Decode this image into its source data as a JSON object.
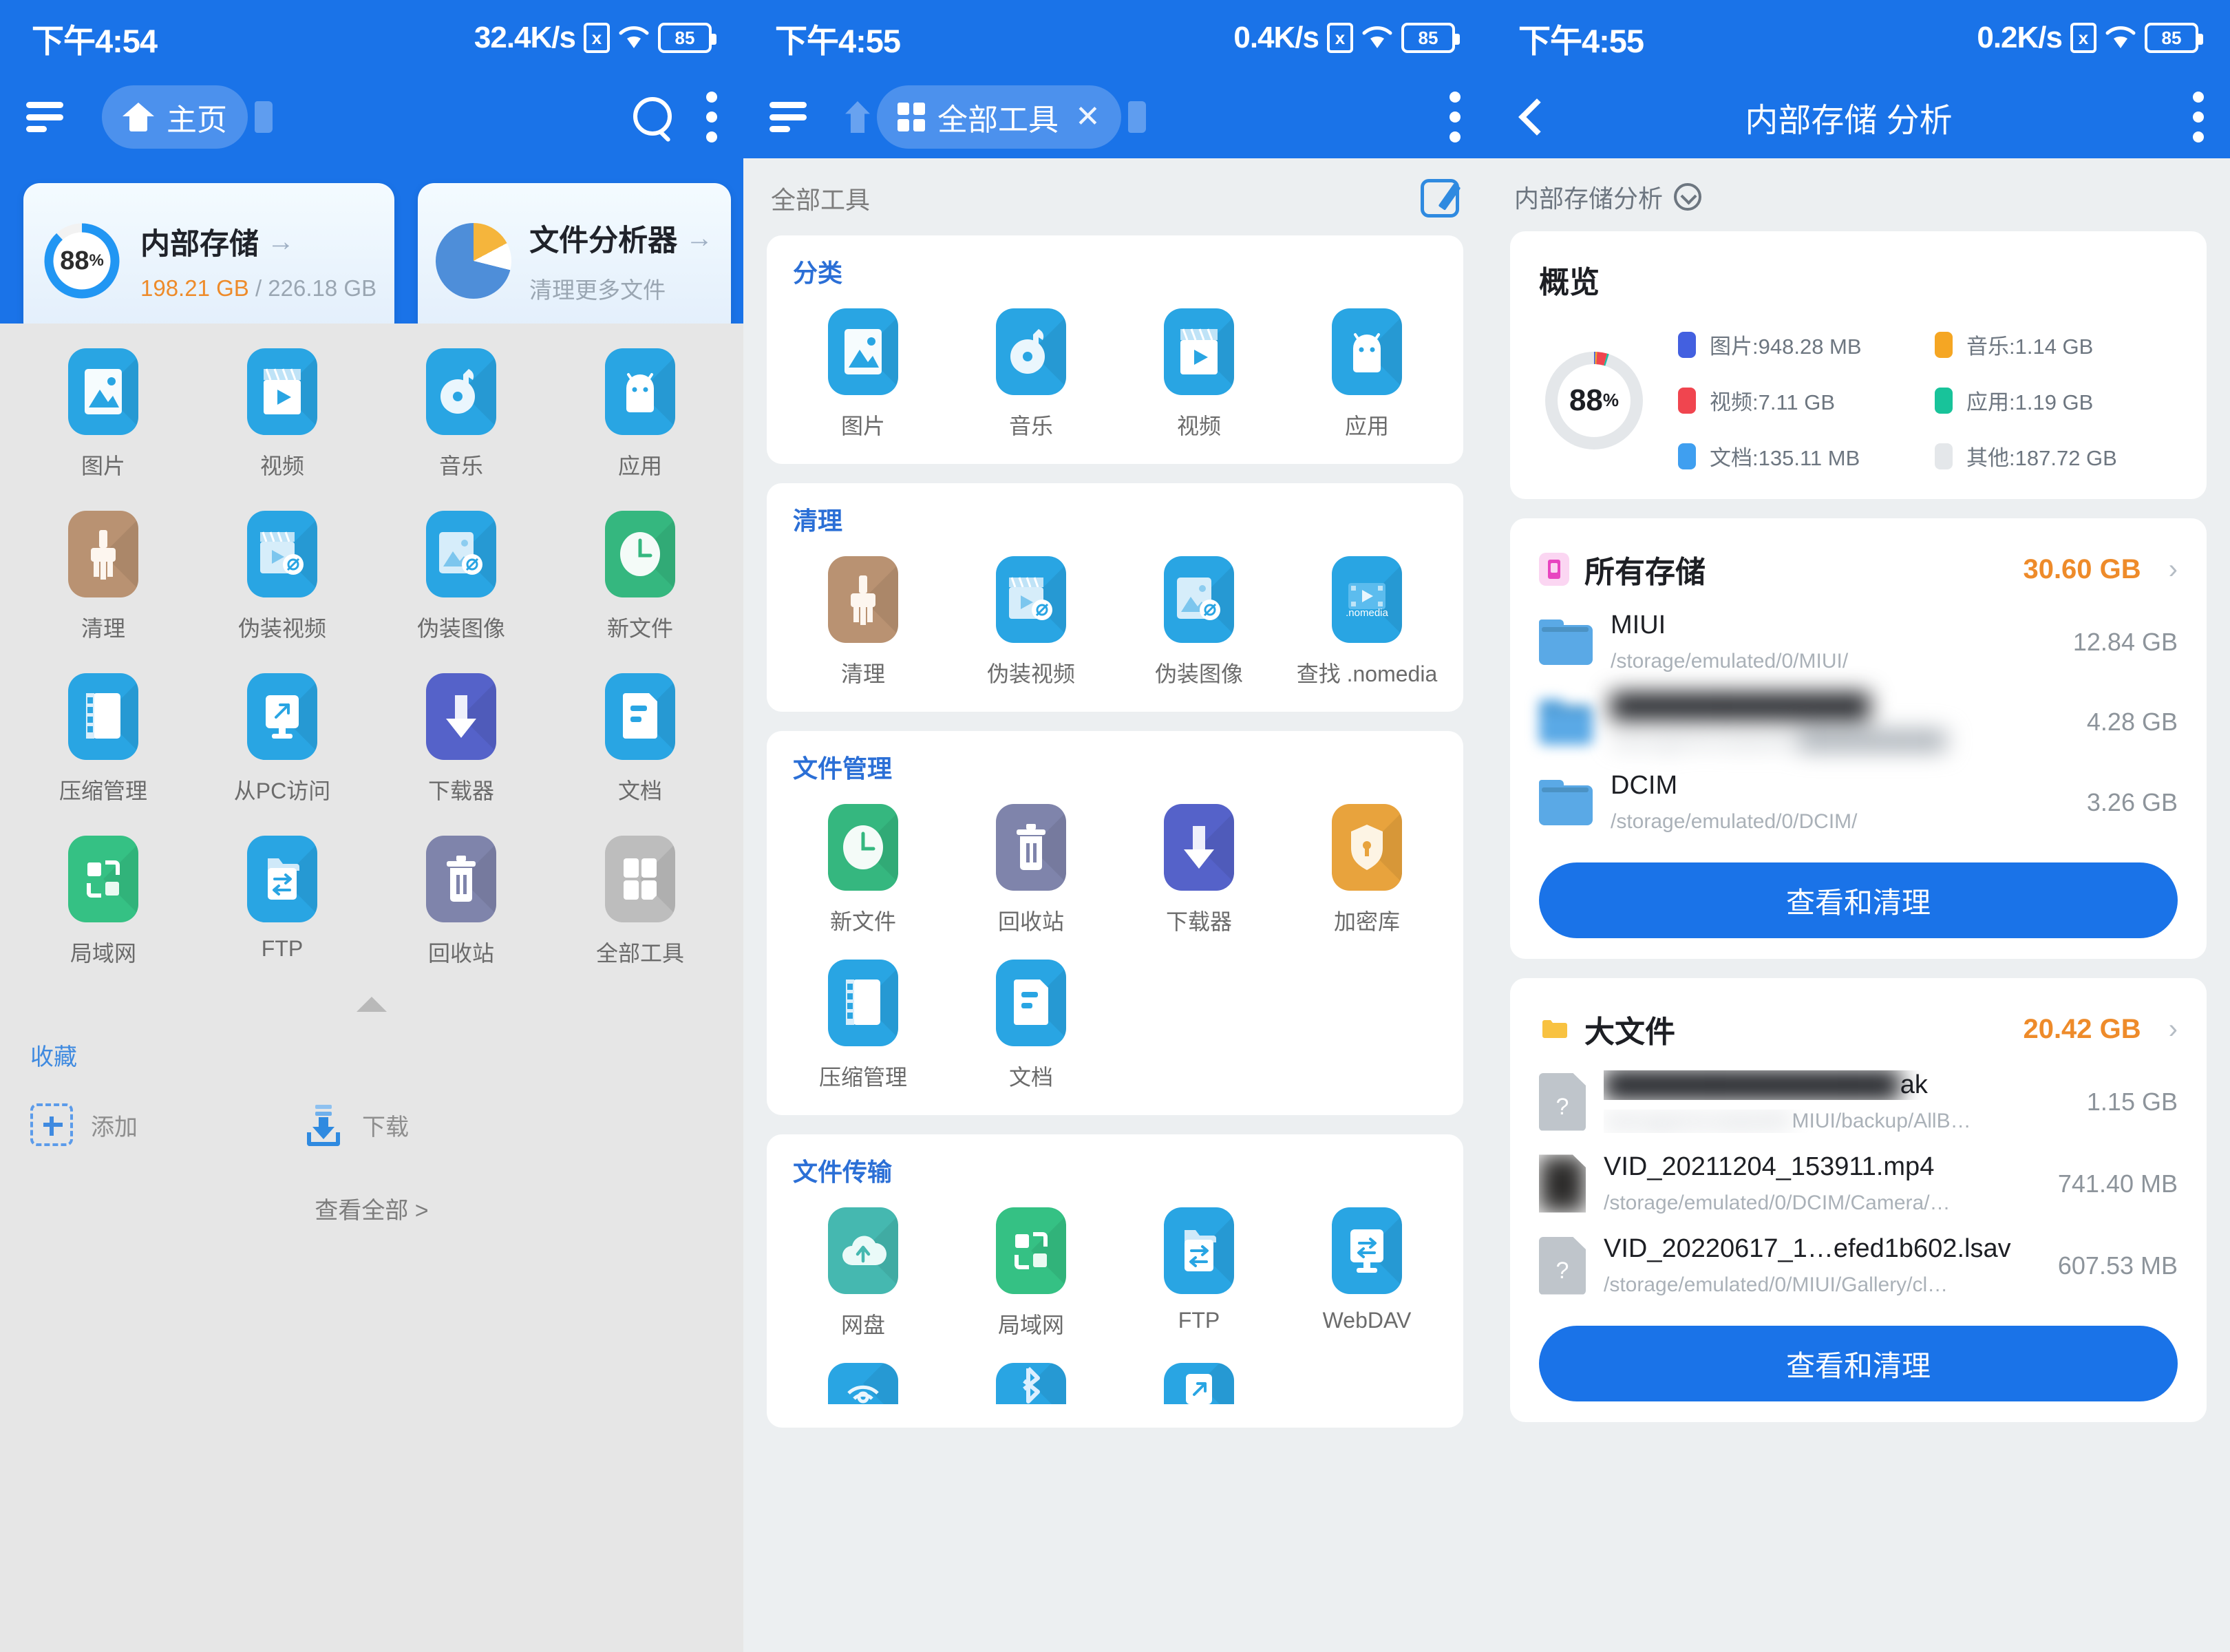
{
  "panel1": {
    "status": {
      "time": "下午4:54",
      "speed": "32.4K/s",
      "x_icon": "x",
      "battery": "85"
    },
    "appbar": {
      "home_label": "主页",
      "search_icon": "search-icon",
      "menu_icon": "kebab-menu-icon"
    },
    "cards": [
      {
        "title": "内部存储",
        "arrow": "→",
        "percent": "88",
        "pct_symbol": "%",
        "used": "198.21 GB",
        "sep": "/",
        "total": "226.18 GB"
      },
      {
        "title": "文件分析器",
        "arrow": "→",
        "sub": "清理更多文件"
      }
    ],
    "grid": [
      {
        "label": "图片",
        "icon": "image-icon"
      },
      {
        "label": "视频",
        "icon": "video-icon"
      },
      {
        "label": "音乐",
        "icon": "music-icon"
      },
      {
        "label": "应用",
        "icon": "android-app-icon"
      },
      {
        "label": "清理",
        "icon": "broom-clean-icon"
      },
      {
        "label": "伪装视频",
        "icon": "hidden-video-icon"
      },
      {
        "label": "伪装图像",
        "icon": "hidden-image-icon"
      },
      {
        "label": "新文件",
        "icon": "clock-new-file-icon"
      },
      {
        "label": "压缩管理",
        "icon": "zip-archive-icon"
      },
      {
        "label": "从PC访问",
        "icon": "pc-monitor-icon"
      },
      {
        "label": "下载器",
        "icon": "download-arrow-icon"
      },
      {
        "label": "文档",
        "icon": "document-icon"
      },
      {
        "label": "局域网",
        "icon": "lan-network-icon"
      },
      {
        "label": "FTP",
        "icon": "ftp-transfer-icon"
      },
      {
        "label": "回收站",
        "icon": "trash-bin-icon"
      },
      {
        "label": "全部工具",
        "icon": "all-tools-grid-icon"
      }
    ],
    "favorites_title": "收藏",
    "favorites": [
      {
        "label": "添加",
        "icon": "plus-add-icon"
      },
      {
        "label": "下载",
        "icon": "download-tray-icon"
      }
    ],
    "see_all": "查看全部 >"
  },
  "panel2": {
    "status": {
      "time": "下午4:55",
      "speed": "0.4K/s",
      "x_icon": "x",
      "battery": "85"
    },
    "appbar": {
      "tab_label": "全部工具",
      "close": "✕"
    },
    "page_title": "全部工具",
    "edit_icon": "edit-pencil-icon",
    "sections": [
      {
        "title": "分类",
        "items": [
          {
            "label": "图片",
            "icon": "image-icon"
          },
          {
            "label": "音乐",
            "icon": "music-icon"
          },
          {
            "label": "视频",
            "icon": "video-icon"
          },
          {
            "label": "应用",
            "icon": "android-app-icon"
          }
        ]
      },
      {
        "title": "清理",
        "items": [
          {
            "label": "清理",
            "icon": "broom-clean-icon"
          },
          {
            "label": "伪装视频",
            "icon": "hidden-video-icon"
          },
          {
            "label": "伪装图像",
            "icon": "hidden-image-icon"
          },
          {
            "label": "查找 .nomedia",
            "icon": "nomedia-icon"
          }
        ]
      },
      {
        "title": "文件管理",
        "items": [
          {
            "label": "新文件",
            "icon": "clock-new-file-icon"
          },
          {
            "label": "回收站",
            "icon": "trash-bin-icon"
          },
          {
            "label": "下载器",
            "icon": "download-arrow-icon"
          },
          {
            "label": "加密库",
            "icon": "shield-lock-icon"
          },
          {
            "label": "压缩管理",
            "icon": "zip-archive-icon"
          },
          {
            "label": "文档",
            "icon": "document-icon"
          }
        ]
      },
      {
        "title": "文件传输",
        "items": [
          {
            "label": "网盘",
            "icon": "cloud-upload-icon"
          },
          {
            "label": "局域网",
            "icon": "lan-network-icon"
          },
          {
            "label": "FTP",
            "icon": "ftp-transfer-icon"
          },
          {
            "label": "WebDAV",
            "icon": "webdav-monitor-icon"
          }
        ]
      }
    ]
  },
  "panel3": {
    "status": {
      "time": "下午4:55",
      "speed": "0.2K/s",
      "x_icon": "x",
      "battery": "85"
    },
    "appbar": {
      "title": "内部存储 分析",
      "back": "back-chevron-icon",
      "menu": "kebab-menu-icon"
    },
    "breadcrumb": "内部存储分析",
    "overview": {
      "title": "概览",
      "percent": "88",
      "pct_symbol": "%"
    },
    "chart_data": {
      "type": "pie",
      "title": "概览",
      "center_label": "88%",
      "legend_position": "right",
      "categories": [
        "图片",
        "视频",
        "文档",
        "音乐",
        "应用",
        "其他"
      ],
      "labels": [
        "图片:948.28 MB",
        "视频:7.11 GB",
        "文档:135.11 MB",
        "音乐:1.14 GB",
        "应用:1.19 GB",
        "其他:187.72 GB"
      ],
      "values_gb": [
        0.926,
        7.11,
        0.132,
        1.14,
        1.19,
        187.72
      ],
      "display_values": [
        "948.28 MB",
        "7.11 GB",
        "135.11 MB",
        "1.14 GB",
        "1.19 GB",
        "187.72 GB"
      ],
      "colors": [
        "#4360e0",
        "#f0454f",
        "#3f9ff0",
        "#f5a623",
        "#18c39a",
        "#e4e7ea"
      ],
      "total_display": "198.21 GB / 226.18 GB",
      "used_percent": 88
    },
    "sections": [
      {
        "name": "所有存储",
        "size": "30.60 GB",
        "icon": "phone-storage-icon",
        "chevron": "›",
        "rows": [
          {
            "name": "MIUI",
            "path": "/storage/emulated/0/MIUI/",
            "size": "12.84 GB",
            "icon": "folder-icon",
            "blur": false
          },
          {
            "name": "",
            "path": "",
            "size": "4.28 GB",
            "icon": "folder-icon",
            "blur": true
          },
          {
            "name": "DCIM",
            "path": "/storage/emulated/0/DCIM/",
            "size": "3.26 GB",
            "icon": "folder-icon",
            "blur": false
          }
        ],
        "button": "查看和清理"
      },
      {
        "name": "大文件",
        "size": "20.42 GB",
        "icon": "yellow-folder-icon",
        "chevron": "›",
        "rows": [
          {
            "name": "ak",
            "path": "MIUI/backup/AllB…",
            "size": "1.15 GB",
            "icon": "unknown-file-icon",
            "blur": true
          },
          {
            "name": "VID_20211204_153911.mp4",
            "path": "/storage/emulated/0/DCIM/Camera/…",
            "size": "741.40 MB",
            "icon": "video-thumb-icon",
            "blur": false
          },
          {
            "name": "VID_20220617_1…efed1b602.lsav",
            "path": "/storage/emulated/0/MIUI/Gallery/cl…",
            "size": "607.53 MB",
            "icon": "unknown-file-icon",
            "blur": false
          }
        ],
        "button": "查看和清理"
      }
    ]
  },
  "colors": {
    "brand_blue": "#1a73e8",
    "accent_orange": "#ee8b2a",
    "section_heading": "#2b6fd6",
    "panel_bg": "#eceff1"
  }
}
